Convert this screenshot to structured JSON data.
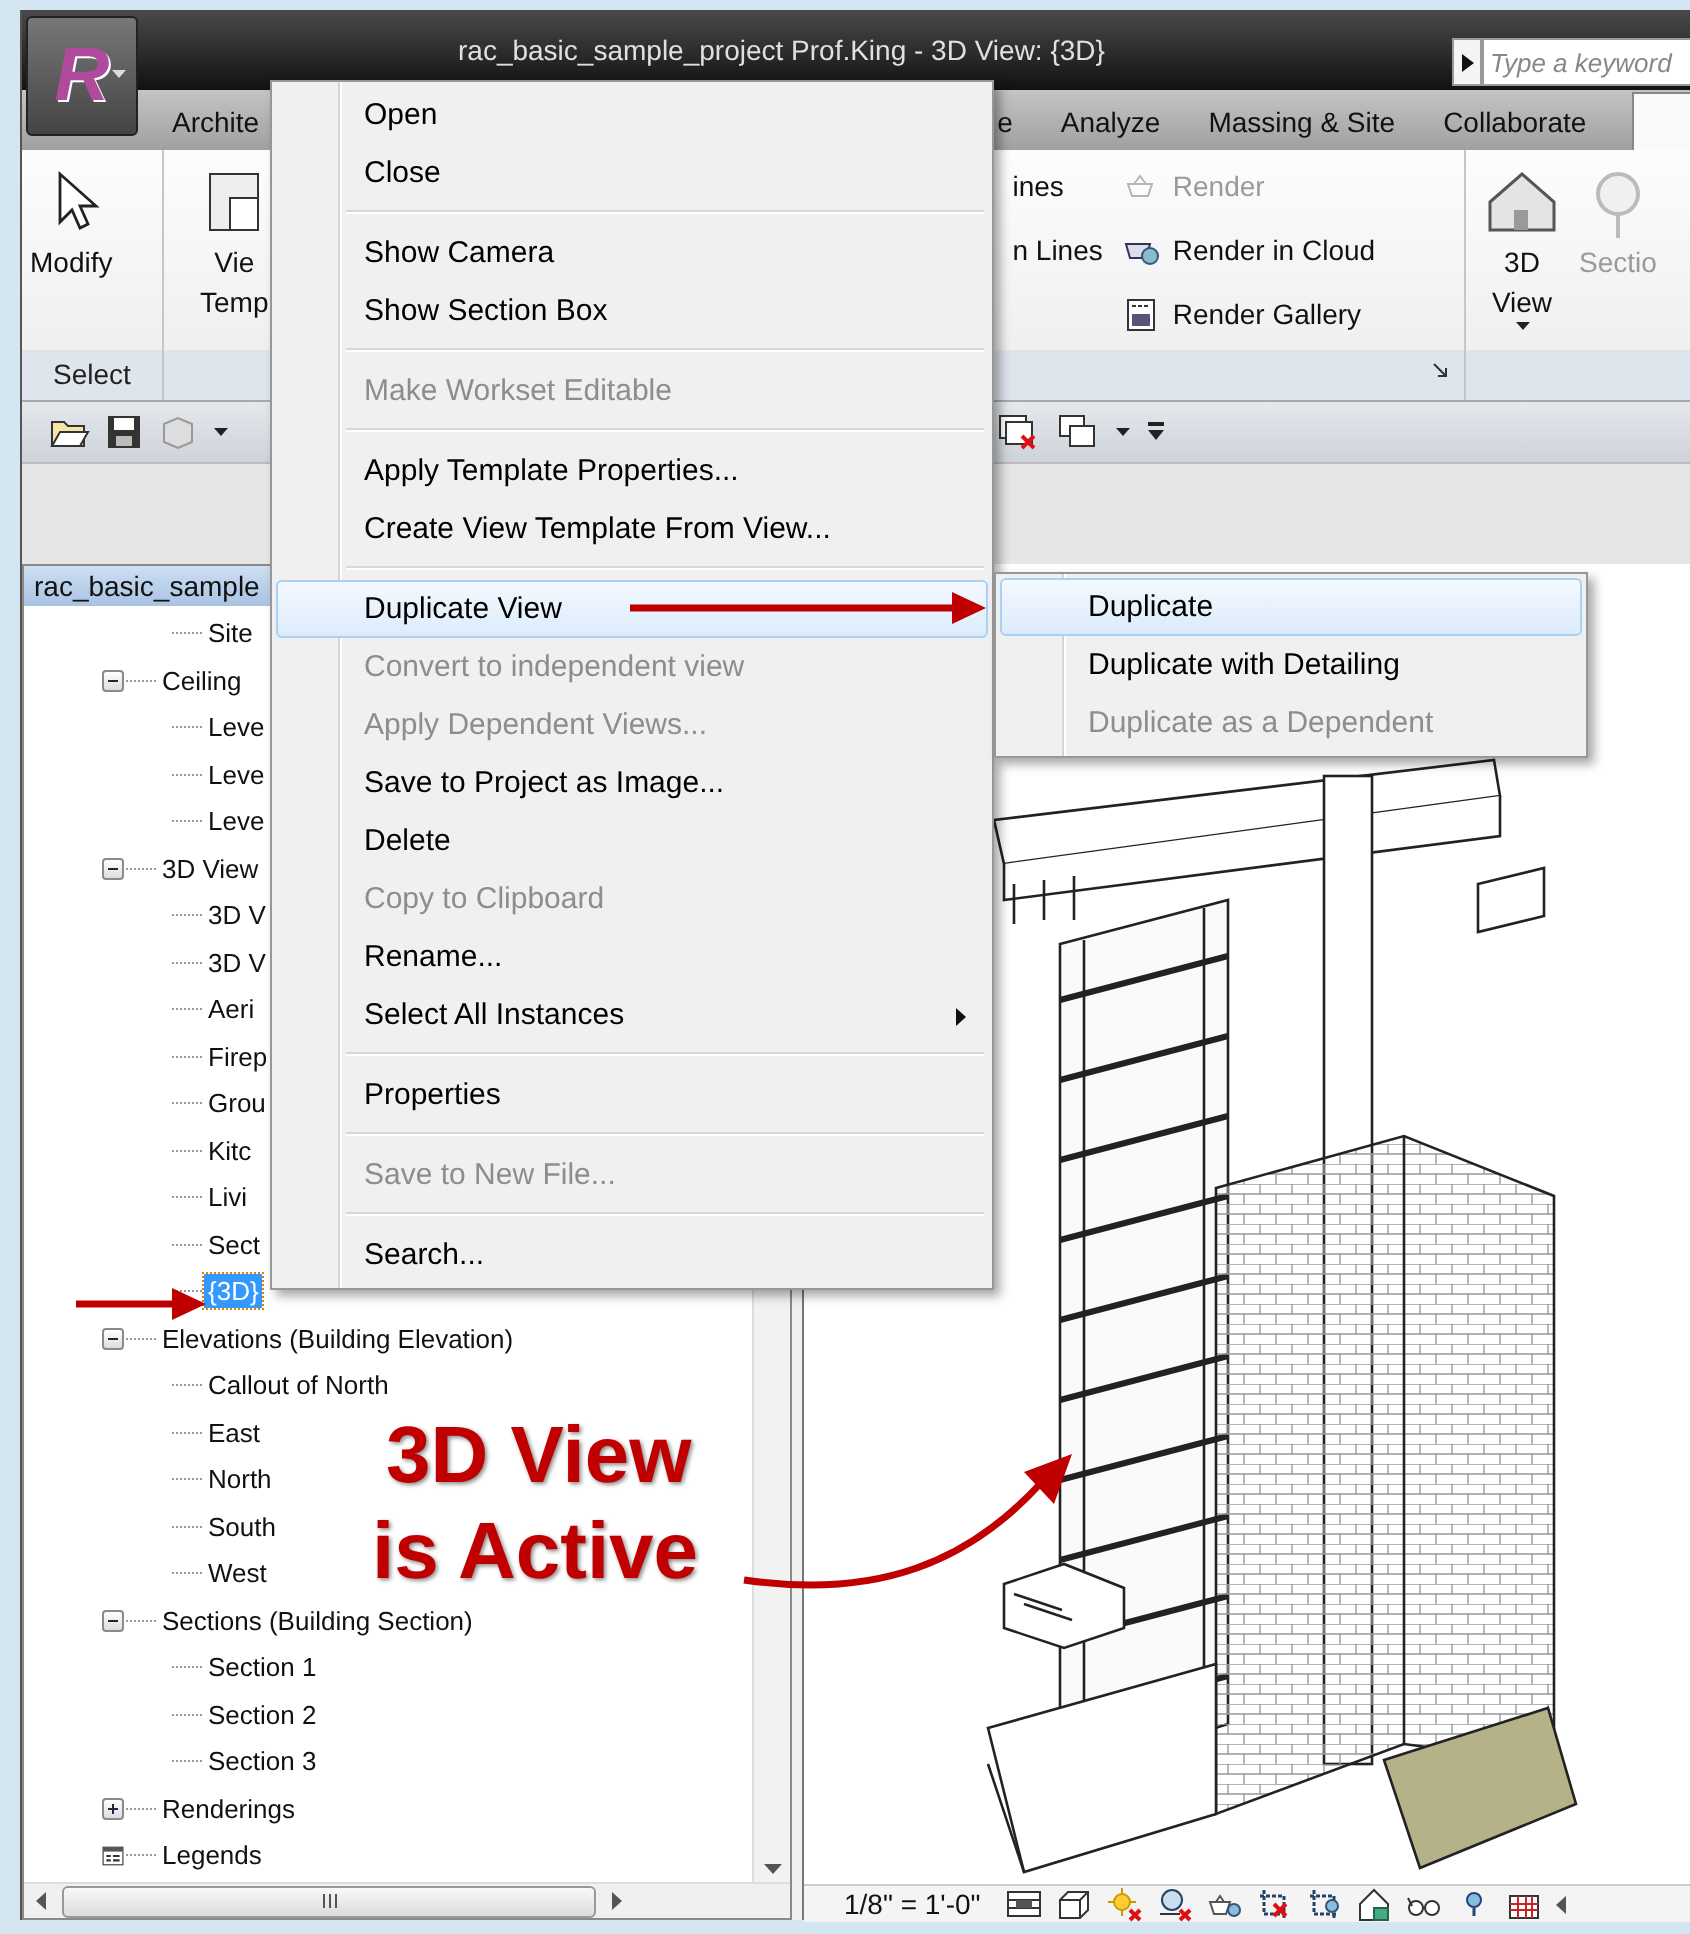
{
  "window": {
    "title": "rac_basic_sample_project Prof.King - 3D View: {3D}"
  },
  "app_button": {
    "logo": "R"
  },
  "search": {
    "placeholder": "Type a keyword"
  },
  "ribbon_tabs": [
    {
      "label": "Archite",
      "selected": false
    },
    {
      "label": "e",
      "selected": false
    },
    {
      "label": "Analyze",
      "selected": false
    },
    {
      "label": "Massing & Site",
      "selected": false
    },
    {
      "label": "Collaborate",
      "selected": false
    },
    {
      "selected": true
    }
  ],
  "ribbon": {
    "modify": {
      "label": "Modify"
    },
    "select_panel_label": "Select",
    "view_templates": {
      "lines": [
        "Vie",
        "Temp"
      ]
    },
    "lines_tools": [
      {
        "label": "ines"
      },
      {
        "label": "n Lines"
      }
    ],
    "render_tools": [
      {
        "label": "Render",
        "disabled": true
      },
      {
        "label": "Render in Cloud",
        "disabled": false
      },
      {
        "label": "Render Gallery",
        "disabled": false
      }
    ],
    "view_tools": [
      {
        "lines": [
          "3D",
          "View"
        ],
        "disabled": false,
        "dropdown": true
      },
      {
        "lines": [
          "Sectio"
        ],
        "disabled": true,
        "dropdown": false
      }
    ]
  },
  "project_browser": {
    "title": "rac_basic_sample",
    "tree": [
      {
        "children": [
          {
            "label": "Site",
            "selected": false
          }
        ]
      },
      {
        "label": "Ceiling",
        "expanded": true,
        "selected": false,
        "children": [
          {
            "label": "Leve",
            "selected": false
          },
          {
            "label": "Leve",
            "selected": false
          },
          {
            "label": "Leve",
            "selected": false
          }
        ]
      },
      {
        "label": "3D View",
        "expanded": true,
        "selected": false,
        "children": [
          {
            "label": "3D V",
            "selected": false
          },
          {
            "label": "3D V",
            "selected": false
          },
          {
            "label": "Aeri",
            "selected": false
          },
          {
            "label": "Firep",
            "selected": false
          },
          {
            "label": "Grou",
            "selected": false
          },
          {
            "label": "Kitc",
            "selected": false
          },
          {
            "label": "Livi",
            "selected": false
          },
          {
            "label": "Sect",
            "selected": false
          },
          {
            "label": "{3D}",
            "selected": true
          }
        ]
      },
      {
        "label": "Elevations (Building Elevation)",
        "expanded": true,
        "selected": false,
        "children": [
          {
            "label": "Callout of North",
            "selected": false
          },
          {
            "label": "East",
            "selected": false
          },
          {
            "label": "North",
            "selected": false
          },
          {
            "label": "South",
            "selected": false
          },
          {
            "label": "West",
            "selected": false
          }
        ]
      },
      {
        "label": "Sections (Building Section)",
        "expanded": true,
        "selected": false,
        "children": [
          {
            "label": "Section 1",
            "selected": false
          },
          {
            "label": "Section 2",
            "selected": false
          },
          {
            "label": "Section 3",
            "selected": false
          }
        ]
      },
      {
        "label": "Renderings",
        "expanded": false,
        "selected": false
      },
      {
        "label": "Legends",
        "selected": false
      }
    ]
  },
  "context_menu": {
    "groups": [
      {
        "items": [
          {
            "label": "Open",
            "disabled": false,
            "selected": false,
            "submenu": false
          },
          {
            "label": "Close",
            "disabled": false,
            "selected": false,
            "submenu": false
          }
        ]
      },
      {
        "items": [
          {
            "label": "Show Camera",
            "disabled": false,
            "selected": false,
            "submenu": false
          },
          {
            "label": "Show Section Box",
            "disabled": false,
            "selected": false,
            "submenu": false
          }
        ]
      },
      {
        "items": [
          {
            "label": "Make Workset Editable",
            "disabled": true,
            "selected": false,
            "submenu": false
          }
        ]
      },
      {
        "items": [
          {
            "label": "Apply Template Properties...",
            "disabled": false,
            "selected": false,
            "submenu": false
          },
          {
            "label": "Create View Template From View...",
            "disabled": false,
            "selected": false,
            "submenu": false
          }
        ]
      },
      {
        "items": [
          {
            "label": "Duplicate View",
            "disabled": false,
            "selected": true,
            "submenu": true
          },
          {
            "label": "Convert to independent view",
            "disabled": true,
            "selected": false,
            "submenu": false
          },
          {
            "label": "Apply Dependent Views...",
            "disabled": true,
            "selected": false,
            "submenu": false
          },
          {
            "label": "Save to Project as Image...",
            "disabled": false,
            "selected": false,
            "submenu": false
          },
          {
            "label": "Delete",
            "disabled": false,
            "selected": false,
            "submenu": false
          },
          {
            "label": "Copy to Clipboard",
            "disabled": true,
            "selected": false,
            "submenu": false
          },
          {
            "label": "Rename...",
            "disabled": false,
            "selected": false,
            "submenu": false
          },
          {
            "label": "Select All Instances",
            "disabled": false,
            "selected": false,
            "submenu": true
          }
        ]
      },
      {
        "items": [
          {
            "label": "Properties",
            "disabled": false,
            "selected": false,
            "submenu": false
          }
        ]
      },
      {
        "items": [
          {
            "label": "Save to New File...",
            "disabled": true,
            "selected": false,
            "submenu": false
          }
        ]
      },
      {
        "items": [
          {
            "label": "Search...",
            "disabled": false,
            "selected": false,
            "submenu": false
          }
        ]
      }
    ]
  },
  "submenu": {
    "items": [
      {
        "label": "Duplicate",
        "disabled": false,
        "selected": true
      },
      {
        "label": "Duplicate with Detailing",
        "disabled": false,
        "selected": false
      },
      {
        "label": "Duplicate as a Dependent",
        "disabled": true,
        "selected": false
      }
    ]
  },
  "callout": {
    "lines": [
      "3D View",
      "is Active"
    ]
  },
  "status_bar": {
    "scale": "1/8\" = 1'-0\""
  }
}
